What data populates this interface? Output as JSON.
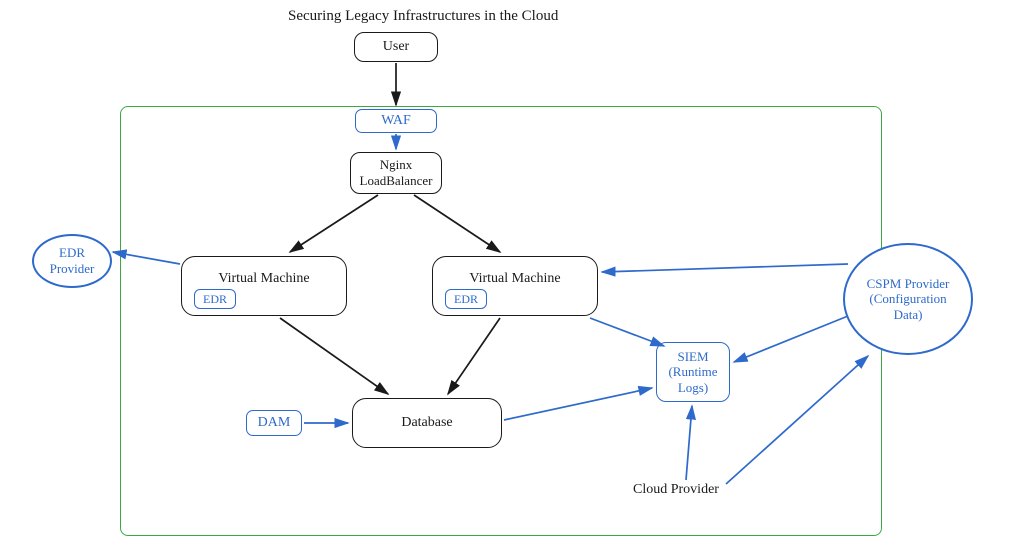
{
  "title": "Securing Legacy Infrastructures in the Cloud",
  "nodes": {
    "user": "User",
    "waf": "WAF",
    "nginx_line1": "Nginx",
    "nginx_line2": "LoadBalancer",
    "vm1": "Virtual Machine",
    "vm2": "Virtual Machine",
    "edr_badge": "EDR",
    "edr_provider_line1": "EDR",
    "edr_provider_line2": "Provider",
    "dam": "DAM",
    "database": "Database",
    "siem_line1": "SIEM",
    "siem_line2": "(Runtime",
    "siem_line3": "Logs)",
    "cspm_line1": "CSPM Provider",
    "cspm_line2": "(Configuration",
    "cspm_line3": "Data)",
    "cloud_provider": "Cloud Provider"
  }
}
